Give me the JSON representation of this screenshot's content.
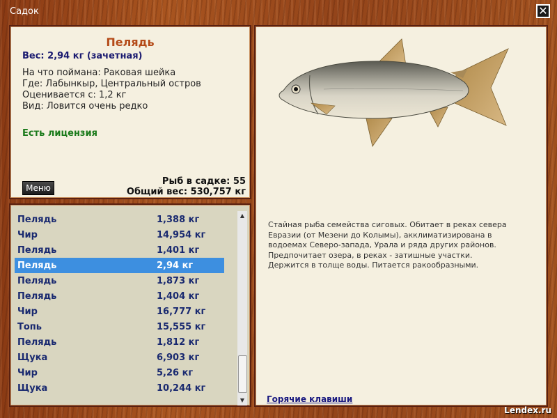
{
  "window": {
    "title": "Садок",
    "close_icon": "close-icon"
  },
  "fish": {
    "name": "Пелядь",
    "weight": "Вес: 2,94 кг (зачетная)",
    "caught_on": "На что поймана: Раковая шейка",
    "location": "Где: Лабынкыр, Центральный остров",
    "rated_from": "Оценивается с: 1,2 кг",
    "kind": "Вид: Ловится очень редко",
    "license": "Есть лицензия"
  },
  "buttons": {
    "menu": "Меню"
  },
  "summary": {
    "count": "Рыб в садке: 55",
    "total_weight": "Общий вес: 530,757 кг"
  },
  "catch_list": [
    {
      "name": "Пелядь",
      "weight": "1,388 кг",
      "selected": false
    },
    {
      "name": "Чир",
      "weight": "14,954 кг",
      "selected": false
    },
    {
      "name": "Пелядь",
      "weight": "1,401 кг",
      "selected": false
    },
    {
      "name": "Пелядь",
      "weight": "2,94 кг",
      "selected": true
    },
    {
      "name": "Пелядь",
      "weight": "1,873 кг",
      "selected": false
    },
    {
      "name": "Пелядь",
      "weight": "1,404 кг",
      "selected": false
    },
    {
      "name": "Чир",
      "weight": "16,777 кг",
      "selected": false
    },
    {
      "name": "Топь",
      "weight": "15,555 кг",
      "selected": false
    },
    {
      "name": "Пелядь",
      "weight": "1,812 кг",
      "selected": false
    },
    {
      "name": "Щука",
      "weight": "6,903 кг",
      "selected": false
    },
    {
      "name": "Чир",
      "weight": "5,26 кг",
      "selected": false
    },
    {
      "name": "Щука",
      "weight": "10,244 кг",
      "selected": false
    }
  ],
  "description": [
    "Стайная рыба семейства сиговых. Обитает в реках севера",
    "Евразии (от Мезени до Колымы), акклиматизирована в",
    "водоемах Северо-запада, Урала и ряда других районов.",
    "Предпочитает озера, в реках - затишные участки.",
    "Держится в толще воды. Питается ракообразными."
  ],
  "links": {
    "hotkeys": "Горячие клавиши"
  },
  "watermark": "Lendex.ru",
  "colors": {
    "selected_row": "#3d8fe0",
    "fish_name": "#b44a18",
    "license": "#1a7a1a",
    "list_text": "#1a2a70"
  }
}
